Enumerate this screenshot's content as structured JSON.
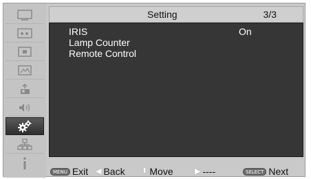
{
  "header": {
    "title": "Setting",
    "page": "3/3"
  },
  "menu": {
    "items": [
      {
        "label": "IRIS",
        "value": "On"
      },
      {
        "label": "Lamp Counter",
        "value": ""
      },
      {
        "label": "Remote Control",
        "value": ""
      }
    ]
  },
  "footer": {
    "menu_key": "MENU",
    "exit": "Exit",
    "back": "Back",
    "move": "Move",
    "next_placeholder": "----",
    "select_key": "SELECT",
    "next": "Next"
  },
  "sidebar": {
    "icons": [
      "display-icon",
      "input-icon",
      "screen-icon",
      "image-adjust-icon",
      "projector-icon",
      "sound-icon",
      "setting-gears-icon",
      "network-icon",
      "info-icon"
    ],
    "active_index": 6
  }
}
